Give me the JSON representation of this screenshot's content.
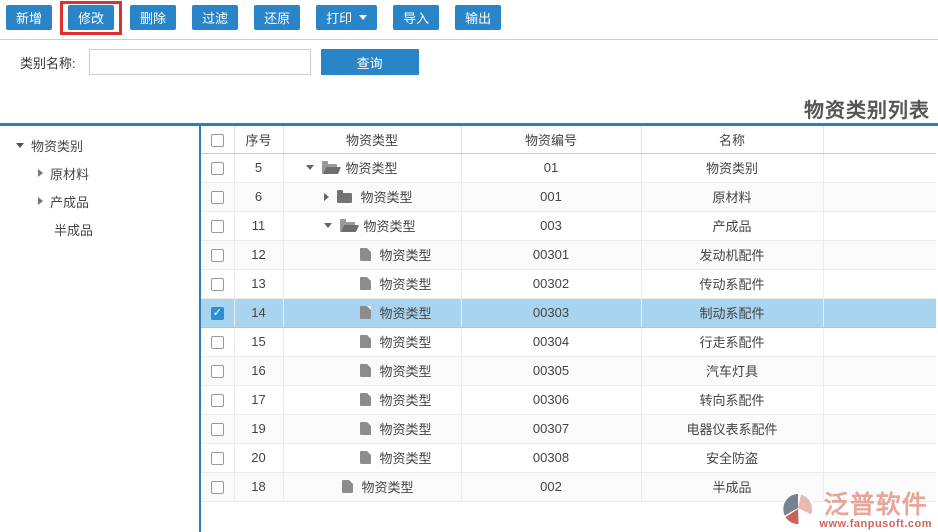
{
  "toolbar": {
    "buttons": [
      {
        "label": "新增"
      },
      {
        "label": "修改",
        "highlighted": true
      },
      {
        "label": "删除"
      },
      {
        "label": "过滤"
      },
      {
        "label": "还原"
      },
      {
        "label": "打印",
        "has_dropdown": true
      },
      {
        "label": "导入"
      },
      {
        "label": "输出"
      }
    ]
  },
  "search": {
    "label": "类别名称:",
    "input_value": "",
    "button": "查询"
  },
  "page_title": "物资类别列表",
  "tree": {
    "items": [
      {
        "label": "物资类别",
        "state": "expanded"
      },
      {
        "label": "原材料",
        "state": "collapsed"
      },
      {
        "label": "产成品",
        "state": "collapsed"
      },
      {
        "label": "半成品",
        "state": "leaf"
      }
    ]
  },
  "table": {
    "columns": {
      "seq": "序号",
      "type": "物资类型",
      "code": "物资编号",
      "name": "名称"
    },
    "rows": [
      {
        "seq": "5",
        "type": "物资类型",
        "code": "01",
        "name": "物资类别",
        "icon": "folder-open",
        "expander": "down",
        "level": 1,
        "checked": false,
        "selected": false
      },
      {
        "seq": "6",
        "type": "物资类型",
        "code": "001",
        "name": "原材料",
        "icon": "folder-closed",
        "expander": "right",
        "level": 2,
        "checked": false,
        "selected": false
      },
      {
        "seq": "11",
        "type": "物资类型",
        "code": "003",
        "name": "产成品",
        "icon": "folder-open",
        "expander": "down",
        "level": 2,
        "checked": false,
        "selected": false
      },
      {
        "seq": "12",
        "type": "物资类型",
        "code": "00301",
        "name": "发动机配件",
        "icon": "file",
        "expander": "none",
        "level": 3,
        "checked": false,
        "selected": false
      },
      {
        "seq": "13",
        "type": "物资类型",
        "code": "00302",
        "name": "传动系配件",
        "icon": "file",
        "expander": "none",
        "level": 3,
        "checked": false,
        "selected": false
      },
      {
        "seq": "14",
        "type": "物资类型",
        "code": "00303",
        "name": "制动系配件",
        "icon": "file",
        "expander": "none",
        "level": 3,
        "checked": true,
        "selected": true
      },
      {
        "seq": "15",
        "type": "物资类型",
        "code": "00304",
        "name": "行走系配件",
        "icon": "file",
        "expander": "none",
        "level": 3,
        "checked": false,
        "selected": false
      },
      {
        "seq": "16",
        "type": "物资类型",
        "code": "00305",
        "name": "汽车灯具",
        "icon": "file",
        "expander": "none",
        "level": 3,
        "checked": false,
        "selected": false
      },
      {
        "seq": "17",
        "type": "物资类型",
        "code": "00306",
        "name": "转向系配件",
        "icon": "file",
        "expander": "none",
        "level": 3,
        "checked": false,
        "selected": false
      },
      {
        "seq": "19",
        "type": "物资类型",
        "code": "00307",
        "name": "电器仪表系配件",
        "icon": "file",
        "expander": "none",
        "level": 3,
        "checked": false,
        "selected": false
      },
      {
        "seq": "20",
        "type": "物资类型",
        "code": "00308",
        "name": "安全防盗",
        "icon": "file",
        "expander": "none",
        "level": 3,
        "checked": false,
        "selected": false
      },
      {
        "seq": "18",
        "type": "物资类型",
        "code": "002",
        "name": "半成品",
        "icon": "file",
        "expander": "none",
        "level": 2,
        "checked": false,
        "selected": false
      }
    ]
  },
  "watermark": {
    "brand": "泛普软件",
    "url": "www.fanpusoft.com"
  },
  "colors": {
    "accent_blue": "#2a85c8",
    "divider_blue": "#2e7fc0",
    "selected_row": "#a9d4f0",
    "highlight_red": "#e02f2f"
  }
}
